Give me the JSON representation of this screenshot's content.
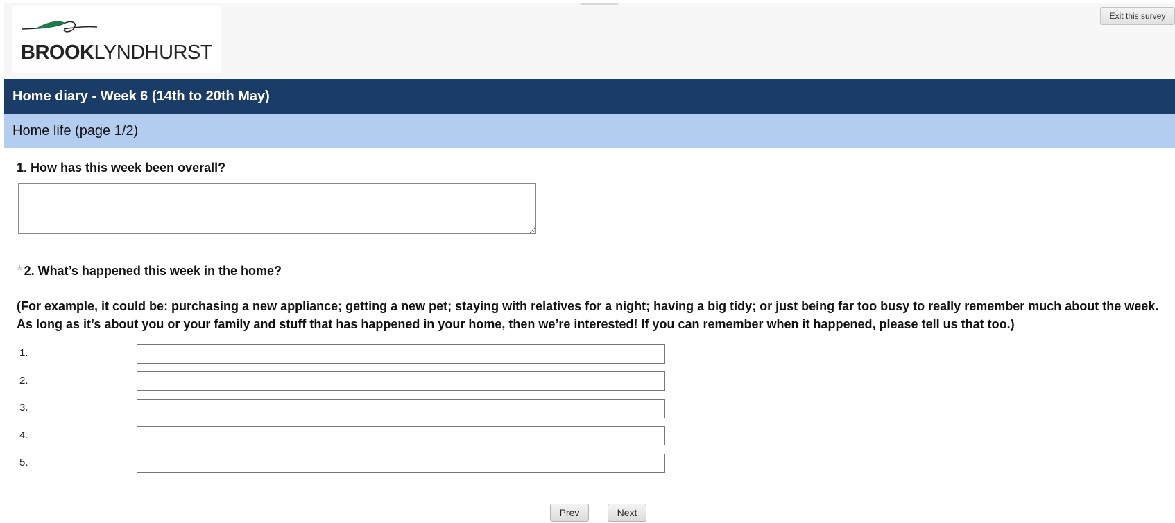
{
  "header": {
    "logo": {
      "brand_bold": "BROOK",
      "brand_regular": "LYNDHURST"
    },
    "exit_label": "Exit this survey"
  },
  "survey": {
    "title": "Home diary - Week 6 (14th to 20th May)",
    "page_title": "Home life (page 1/2)"
  },
  "questions": {
    "q1": {
      "label": "1. How has this week been overall?",
      "value": ""
    },
    "q2": {
      "required_marker": "*",
      "label": "2. What’s happened this week in the home?",
      "description": "(For example, it could be: purchasing a new appliance; getting a new pet; staying with relatives for a night; having a big tidy; or just being far too busy to really remember much about the week. As long as it’s about you or your family and stuff that has happened in your home, then we’re interested! If you can remember when it happened, please tell us that too.)",
      "rows": [
        {
          "label": "1.",
          "value": ""
        },
        {
          "label": "2.",
          "value": ""
        },
        {
          "label": "3.",
          "value": ""
        },
        {
          "label": "4.",
          "value": ""
        },
        {
          "label": "5.",
          "value": ""
        }
      ]
    }
  },
  "nav": {
    "prev_label": "Prev",
    "next_label": "Next"
  },
  "colors": {
    "title_bar": "#1a3c67",
    "page_bar": "#b3cdf0",
    "logo_green": "#1f7a4c"
  }
}
